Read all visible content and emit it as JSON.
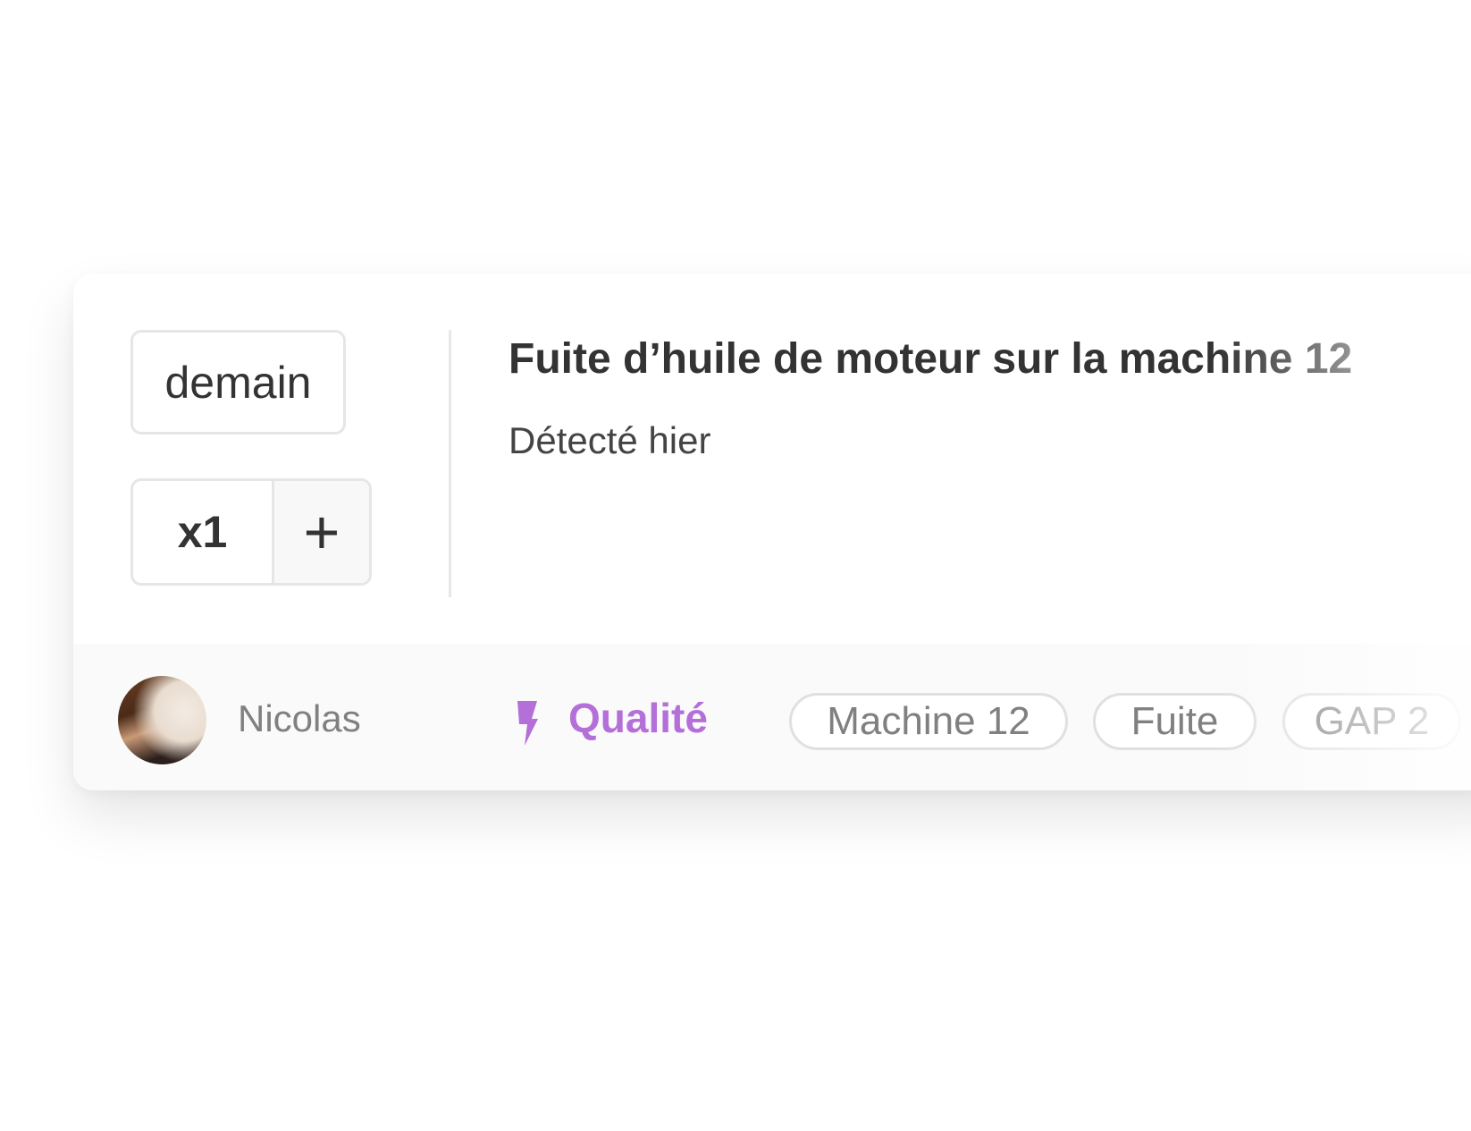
{
  "task": {
    "due": "demain",
    "quantity": "x1",
    "plus_label": "+",
    "title": "Fuite d’huile de moteur sur la machine 12",
    "subtitle": "Détecté hier"
  },
  "footer": {
    "assignee": "Nicolas",
    "category": "Qualité",
    "category_icon": "bolt-icon",
    "category_color": "#b46fd8",
    "tags": [
      "Machine 12",
      "Fuite",
      "GAP 2"
    ]
  }
}
